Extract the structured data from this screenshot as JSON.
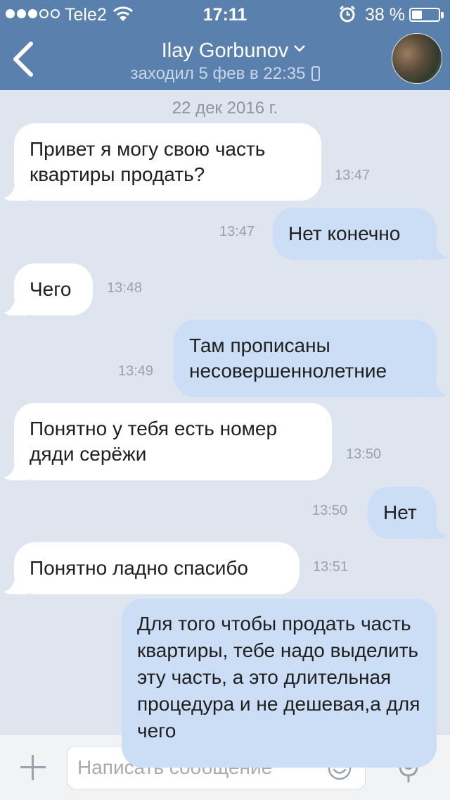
{
  "status_bar": {
    "carrier": "Tele2",
    "time": "17:11",
    "battery_percent": "38 %",
    "battery_level": 0.38,
    "signal_bars_filled": 3,
    "signal_bars_total": 5
  },
  "nav": {
    "contact_name": "Ilay Gorbunov",
    "last_seen": "заходил 5 фев в 22:35"
  },
  "chat": {
    "date_separator": "22 дек 2016 г.",
    "messages": [
      {
        "dir": "in",
        "text": "Привет я могу свою часть квартиры продать?",
        "time": "13:47"
      },
      {
        "dir": "out",
        "text": "Нет конечно",
        "time": "13:47"
      },
      {
        "dir": "in",
        "text": "Чего",
        "time": "13:48"
      },
      {
        "dir": "out",
        "text": "Там прописаны несовершеннолетние",
        "time": "13:49"
      },
      {
        "dir": "in",
        "text": "Понятно у тебя есть номер дяди серёжи",
        "time": "13:50"
      },
      {
        "dir": "out",
        "text": "Нет",
        "time": "13:50"
      },
      {
        "dir": "in",
        "text": "Понятно ладно спасибо",
        "time": "13:51"
      },
      {
        "dir": "out",
        "text": "Для того чтобы продать часть квартиры, тебе надо выделить эту часть, а это длительная процедура и не дешевая,а для чего",
        "time": ""
      }
    ]
  },
  "input": {
    "placeholder": "Написать сообщение"
  },
  "icons": {
    "back": "chevron-left-icon",
    "attach": "plus-icon",
    "emoji": "smiley-icon",
    "voice": "microphone-icon",
    "alarm": "alarm-clock-icon",
    "wifi": "wifi-icon",
    "device": "mobile-phone-icon"
  },
  "colors": {
    "header": "#5a80ad",
    "background": "#dfe5ee",
    "incoming_bubble": "#ffffff",
    "outgoing_bubble": "#ccdef5"
  }
}
